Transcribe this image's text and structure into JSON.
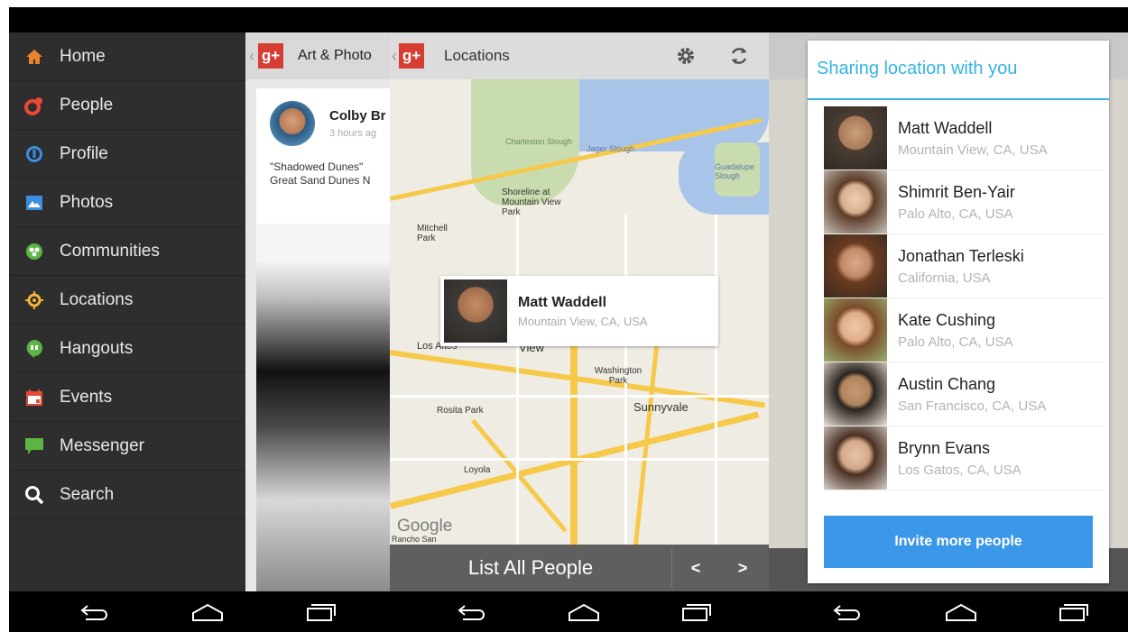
{
  "drawer": {
    "items": [
      {
        "label": "Home",
        "icon": "home-icon",
        "color": "#e8842c"
      },
      {
        "label": "People",
        "icon": "people-icon",
        "color": "#e64a35"
      },
      {
        "label": "Profile",
        "icon": "profile-icon",
        "color": "#3b8ee0"
      },
      {
        "label": "Photos",
        "icon": "photos-icon",
        "color": "#3b8ee0"
      },
      {
        "label": "Communities",
        "icon": "communities-icon",
        "color": "#5ab543"
      },
      {
        "label": "Locations",
        "icon": "locations-icon",
        "color": "#f2b634"
      },
      {
        "label": "Hangouts",
        "icon": "hangouts-icon",
        "color": "#5ab543"
      },
      {
        "label": "Events",
        "icon": "events-icon",
        "color": "#e64a35"
      },
      {
        "label": "Messenger",
        "icon": "messenger-icon",
        "color": "#5ab543"
      },
      {
        "label": "Search",
        "icon": "search-icon",
        "color": "#ffffff"
      }
    ]
  },
  "art_panel": {
    "title": "Art & Photo",
    "author": "Colby Br",
    "time": "3 hours ag",
    "body_line1": "\"Shadowed Dunes\"",
    "body_line2": "Great Sand Dunes N"
  },
  "locations_panel": {
    "title": "Locations",
    "callout_name": "Matt Waddell",
    "callout_place": "Mountain View, CA, USA",
    "map_labels": [
      "Charleston Slough",
      "Jager Slough",
      "Shoreline at Mountain View Park",
      "Guadalupe Slough",
      "Mitchell Park",
      "Mountain View",
      "Los Altos",
      "Washington Park",
      "Sunnyvale",
      "Rosita Park",
      "Loyola",
      "Google",
      "Rancho San"
    ],
    "list_all": "List All People",
    "prev": "<",
    "next": ">"
  },
  "sharing_panel": {
    "title": "Sharing location with you",
    "people": [
      {
        "name": "Matt Waddell",
        "place": "Mountain View, CA, USA"
      },
      {
        "name": "Shimrit Ben-Yair",
        "place": "Palo Alto, CA, USA"
      },
      {
        "name": "Jonathan Terleski",
        "place": "California, USA"
      },
      {
        "name": "Kate Cushing",
        "place": "Palo Alto, CA, USA"
      },
      {
        "name": "Austin Chang",
        "place": "San Francisco, CA, USA"
      },
      {
        "name": "Brynn Evans",
        "place": "Los Gatos, CA, USA"
      }
    ],
    "invite": "Invite more people"
  },
  "brand": {
    "gplus": "g+",
    "accent": "#33b5e5",
    "button": "#3b97e8"
  }
}
